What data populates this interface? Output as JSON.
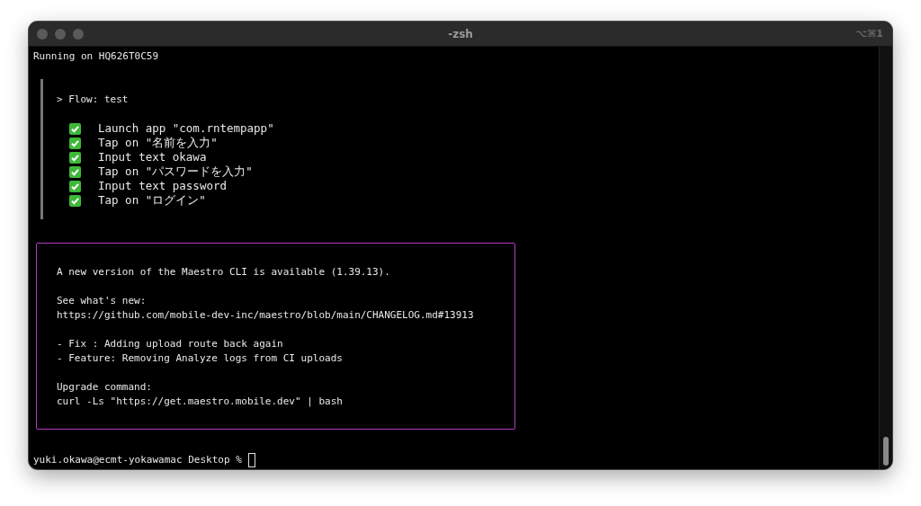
{
  "window": {
    "title": "-zsh",
    "shortcut": "⌥⌘1"
  },
  "running_line": "Running on HQ626T0C59",
  "flow": {
    "header": "> Flow: test",
    "steps": [
      {
        "text": "Launch app \"com.rntempapp\"",
        "passed": true
      },
      {
        "text": "Tap on \"名前を入力\"",
        "passed": true
      },
      {
        "text": "Input text okawa",
        "passed": true
      },
      {
        "text": "Tap on \"パスワードを入力\"",
        "passed": true
      },
      {
        "text": "Input text password",
        "passed": true
      },
      {
        "text": "Tap on \"ログイン\"",
        "passed": true
      }
    ]
  },
  "update_notice": {
    "paragraphs": [
      [
        "A new version of the Maestro CLI is available (1.39.13)."
      ],
      [
        "See what's new:",
        "https://github.com/mobile-dev-inc/maestro/blob/main/CHANGELOG.md#13913"
      ],
      [
        "- Fix : Adding upload route back again",
        "- Feature: Removing Analyze logs from CI uploads"
      ],
      [
        "Upgrade command:",
        "curl -Ls \"https://get.maestro.mobile.dev\" | bash"
      ]
    ]
  },
  "prompt": "yuki.okawa@ecmt-yokawamac Desktop %"
}
